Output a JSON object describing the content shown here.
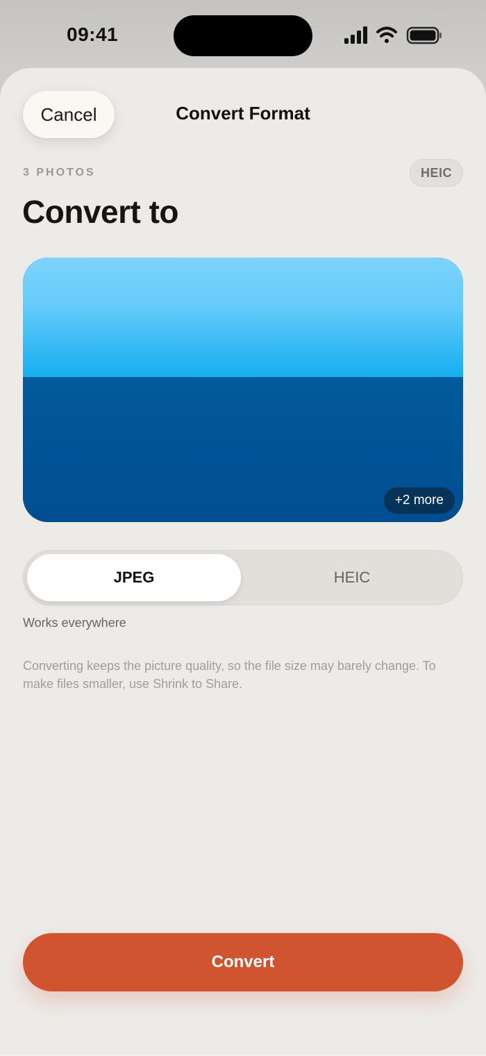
{
  "status_bar": {
    "time": "09:41",
    "icons": [
      "cellular-signal-icon",
      "wifi-icon",
      "battery-icon"
    ]
  },
  "nav": {
    "cancel_label": "Cancel",
    "title": "Convert Format"
  },
  "selection": {
    "photo_count_label": "3 PHOTOS",
    "source_format": "HEIC"
  },
  "heading": "Convert to",
  "preview": {
    "more_label": "+2 more"
  },
  "format_picker": {
    "options": [
      "JPEG",
      "HEIC"
    ],
    "selected": "JPEG",
    "description": "Works everywhere"
  },
  "info_note": "Converting keeps the picture quality, so the file size may barely change. To make files smaller, use Shrink to Share.",
  "primary_action": {
    "label": "Convert"
  },
  "colors": {
    "accent": "#d05430",
    "sheet_background": "#edebe8",
    "segment_selected": "#ffffff"
  }
}
